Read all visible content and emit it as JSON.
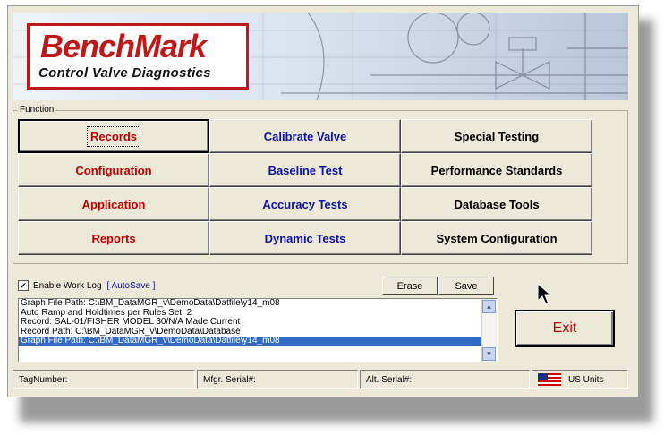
{
  "banner": {
    "logo_bench": "Bench",
    "logo_mark": "Mark",
    "logo_subtitle": "Control Valve Diagnostics"
  },
  "function_group": {
    "legend": "Function",
    "buttons": [
      {
        "label": "Records",
        "color": "#c00000"
      },
      {
        "label": "Calibrate Valve",
        "color": "#1010a8"
      },
      {
        "label": "Special Testing",
        "color": "#000000"
      },
      {
        "label": "Configuration",
        "color": "#c00000"
      },
      {
        "label": "Baseline Test",
        "color": "#1010a8"
      },
      {
        "label": "Performance Standards",
        "color": "#000000"
      },
      {
        "label": "Application",
        "color": "#c00000"
      },
      {
        "label": "Accuracy Tests",
        "color": "#1010a8"
      },
      {
        "label": "Database Tools",
        "color": "#000000"
      },
      {
        "label": "Reports",
        "color": "#c00000"
      },
      {
        "label": "Dynamic Tests",
        "color": "#1010a8"
      },
      {
        "label": "System Configuration",
        "color": "#000000"
      }
    ]
  },
  "worklog": {
    "enable_label": "Enable Work Log",
    "checked": true,
    "autosave_label": "[ AutoSave ]",
    "erase_label": "Erase",
    "save_label": "Save",
    "lines": [
      "Graph File Path: C:\\BM_DataMGR_v\\DemoData\\Datfile\\y14_m08",
      "Auto Ramp and Holdtimes per Rules Set: 2",
      "Record: SAL-01/FISHER MODEL 30/N/A Made Current",
      "Record Path:  C:\\BM_DataMGR_v\\DemoData\\Database",
      "Graph File Path: C:\\BM_DataMGR_v\\DemoData\\Datfile\\y14_m08"
    ],
    "selected_index": 4
  },
  "exit_label": "Exit",
  "status_bar": {
    "tag_number": "TagNumber:",
    "mfgr_serial": "Mfgr. Serial#:",
    "alt_serial": "Alt. Serial#:",
    "units": "US Units"
  },
  "icons": {
    "flag": "us-flag-icon",
    "cursor": "mouse-pointer-icon"
  }
}
